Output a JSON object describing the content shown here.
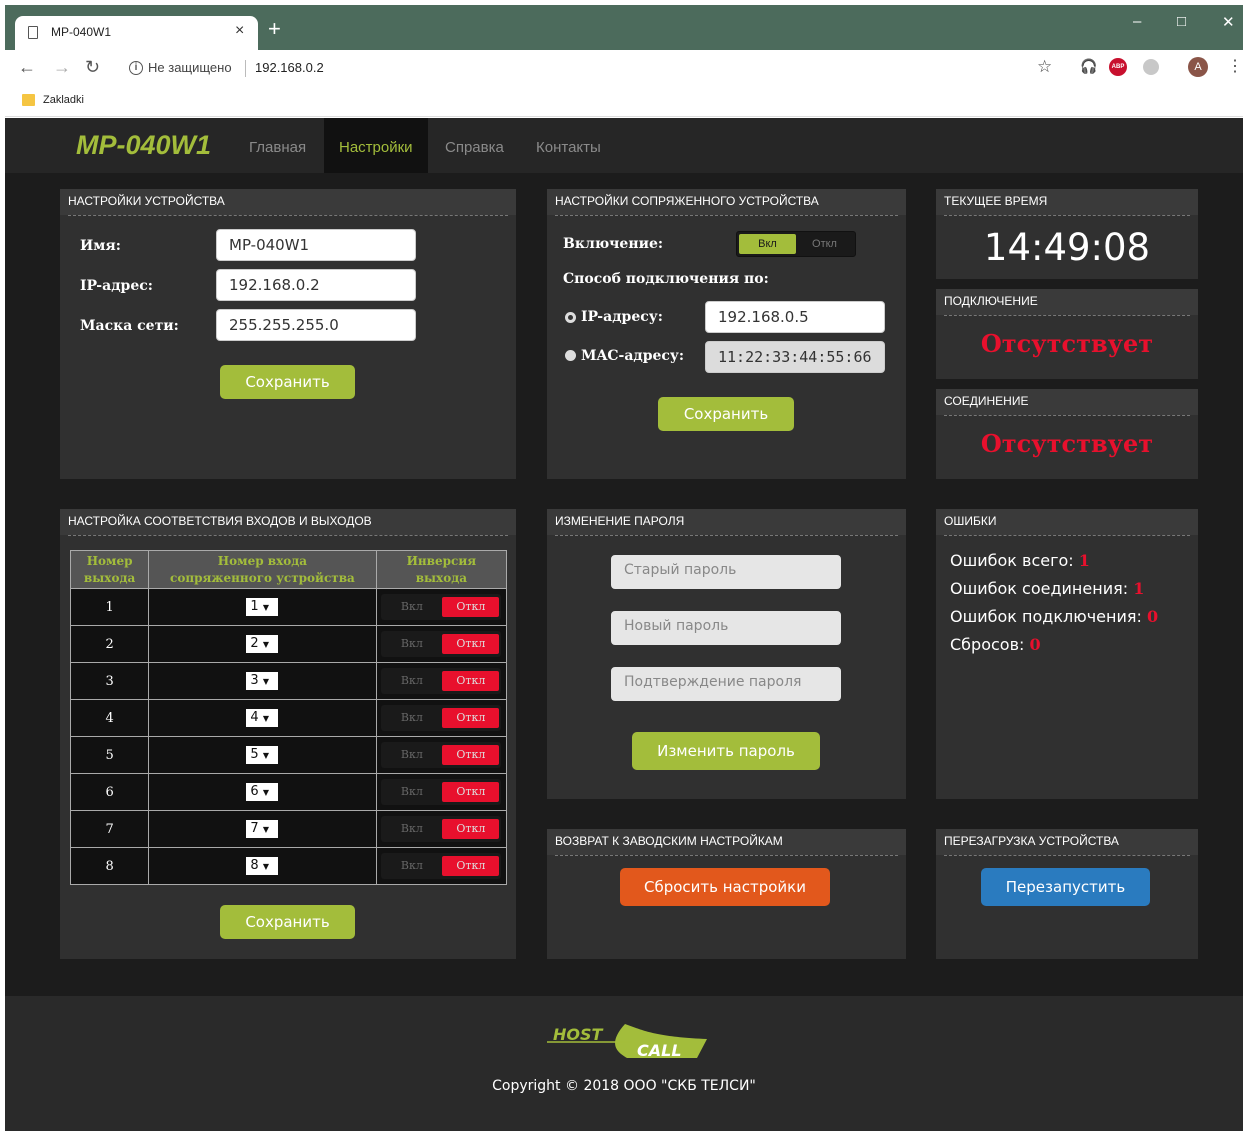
{
  "browser": {
    "tab_title": "MP-040W1",
    "tab_close": "×",
    "new_tab": "+",
    "win_min": "–",
    "win_max": "□",
    "win_close": "✕",
    "not_secure": "Не защищено",
    "url": "192.168.0.2",
    "bookmark": "Zakladki",
    "profile_letter": "A",
    "abp": "ABP"
  },
  "nav": {
    "brand": "MP-040W1",
    "items": [
      "Главная",
      "Настройки",
      "Справка",
      "Контакты"
    ],
    "active": "Настройки"
  },
  "device": {
    "title": "НАСТРОЙКИ УСТРОЙСТВА",
    "name_label": "Имя:",
    "name_value": "MP-040W1",
    "ip_label": "IP-адрес:",
    "ip_value": "192.168.0.2",
    "mask_label": "Маска сети:",
    "mask_value": "255.255.255.0",
    "save": "Сохранить"
  },
  "paired": {
    "title": "НАСТРОЙКИ СОПРЯЖЕННОГО УСТРОЙСТВА",
    "enable_label": "Включение:",
    "on": "Вкл",
    "off": "Откл",
    "method_label": "Способ подключения по:",
    "ip_label": "IP-адресу:",
    "ip_value": "192.168.0.5",
    "mac_label": "MAC-адресу:",
    "mac_value": "11:22:33:44:55:66",
    "save": "Сохранить"
  },
  "time": {
    "title": "ТЕКУЩЕЕ ВРЕМЯ",
    "value": "14:49:08"
  },
  "connection": {
    "title": "ПОДКЛЮЧЕНИЕ",
    "status": "Отсутствует"
  },
  "link": {
    "title": "СОЕДИНЕНИЕ",
    "status": "Отсутствует"
  },
  "io": {
    "title": "НАСТРОЙКА СООТВЕТСТВИЯ ВХОДОВ И ВЫХОДОВ",
    "col1_line1": "Номер",
    "col1_line2": "выхода",
    "col2_line1": "Номер входа",
    "col2_line2": "сопряженного устройства",
    "col3_line1": "Инверсия",
    "col3_line2": "выхода",
    "on": "Вкл",
    "off": "Откл",
    "rows": [
      {
        "out": "1",
        "in": "1"
      },
      {
        "out": "2",
        "in": "2"
      },
      {
        "out": "3",
        "in": "3"
      },
      {
        "out": "4",
        "in": "4"
      },
      {
        "out": "5",
        "in": "5"
      },
      {
        "out": "6",
        "in": "6"
      },
      {
        "out": "7",
        "in": "7"
      },
      {
        "out": "8",
        "in": "8"
      }
    ],
    "save": "Сохранить"
  },
  "password": {
    "title": "ИЗМЕНЕНИЕ ПАРОЛЯ",
    "old_ph": "Старый пароль",
    "new_ph": "Новый пароль",
    "confirm_ph": "Подтверждение пароля",
    "submit": "Изменить пароль"
  },
  "errors": {
    "title": "ОШИБКИ",
    "total_label": "Ошибок всего:",
    "total": "1",
    "link_label": "Ошибок соединения:",
    "link": "1",
    "conn_label": "Ошибок подключения:",
    "conn": "0",
    "resets_label": "Сбросов:",
    "resets": "0"
  },
  "factory": {
    "title": "ВОЗВРАТ К ЗАВОДСКИМ НАСТРОЙКАМ",
    "button": "Сбросить настройки"
  },
  "reboot": {
    "title": "ПЕРЕЗАГРУЗКА УСТРОЙСТВА",
    "button": "Перезапустить"
  },
  "footer": {
    "logo_top": "HOST",
    "logo_bottom": "CALL",
    "copyright": "Copyright © 2018 ООО \"СКБ ТЕЛСИ\""
  },
  "colors": {
    "accent": "#a3bd3b",
    "alert": "#e8102d",
    "orange": "#e2581c",
    "blue": "#2a7bbf"
  }
}
